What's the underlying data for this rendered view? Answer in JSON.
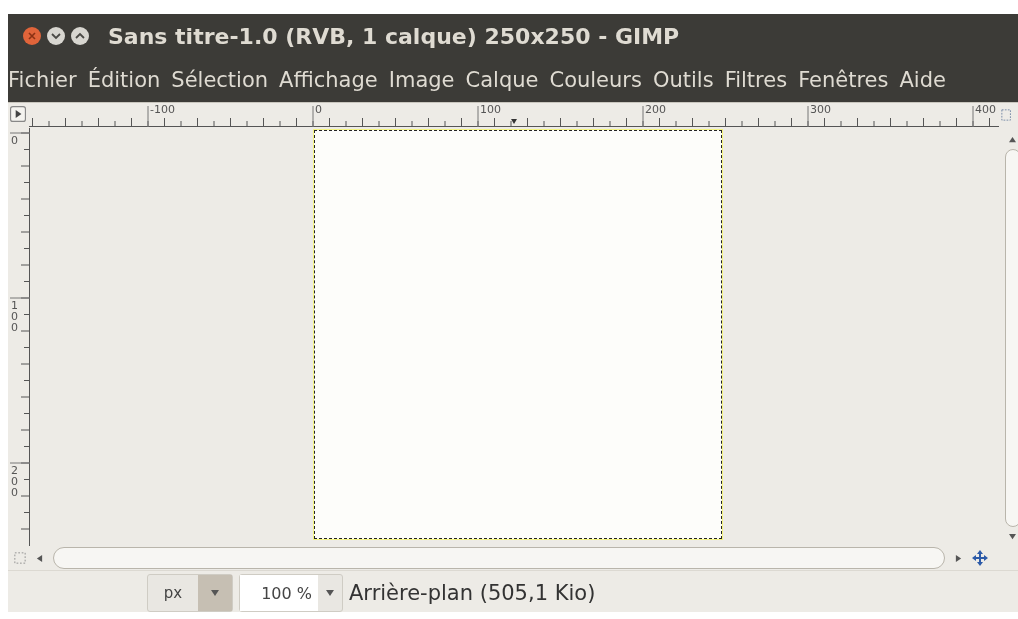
{
  "window": {
    "title": "Sans titre-1.0 (RVB, 1 calque) 250x250 - GIMP"
  },
  "menu": [
    "Fichier",
    "Édition",
    "Sélection",
    "Affichage",
    "Image",
    "Calque",
    "Couleurs",
    "Outils",
    "Filtres",
    "Fenêtres",
    "Aide"
  ],
  "rulers": {
    "horizontal": [
      "-100",
      "0",
      "100",
      "200",
      "300",
      "400"
    ],
    "vertical": [
      "0",
      "100",
      "200"
    ]
  },
  "status_bar": {
    "unit": "px",
    "zoom": "100 %",
    "layer_info": "Arrière-plan (505,1 Kio)"
  }
}
